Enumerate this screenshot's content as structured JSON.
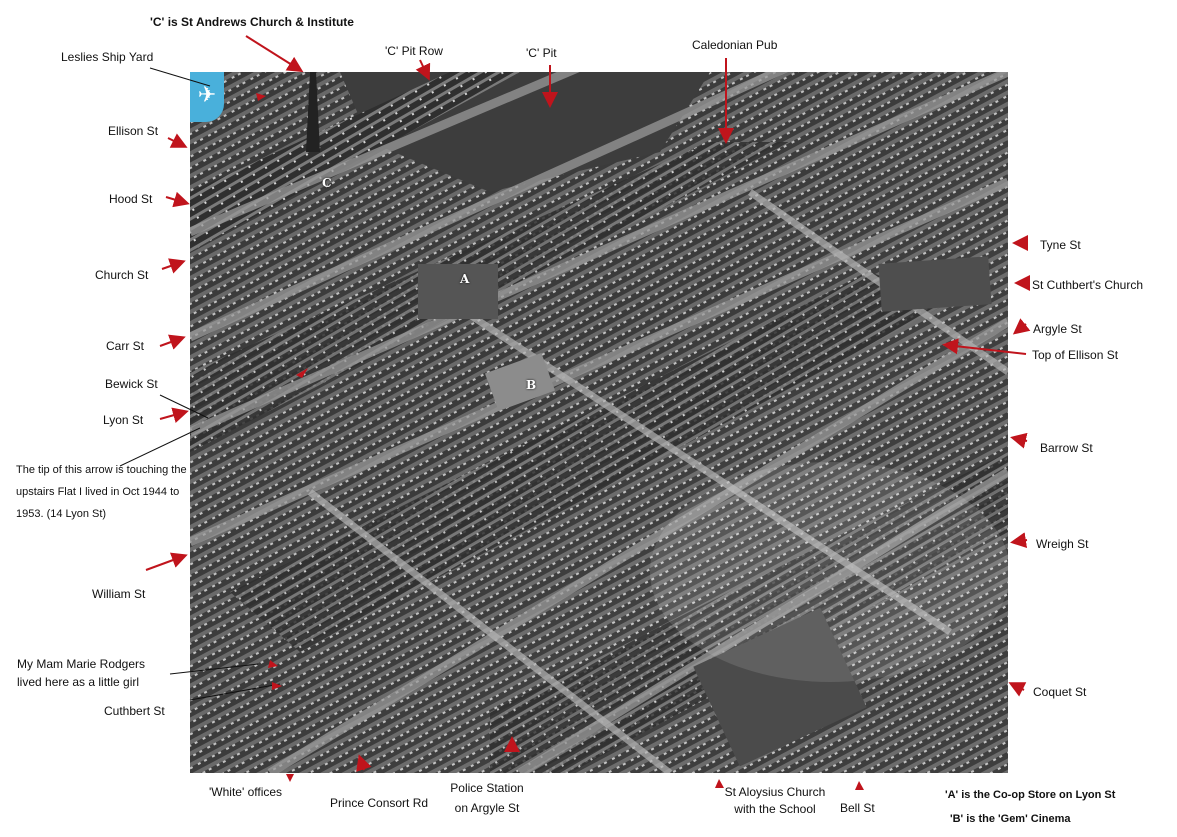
{
  "labels": {
    "st_andrews": "'C' is St Andrews Church & Institute",
    "leslies": "Leslies Ship Yard",
    "pit_row": "'C' Pit Row",
    "pit": "'C' Pit",
    "caledonian": "Caledonian Pub",
    "ellison": "Ellison St",
    "hood": "Hood St",
    "church": "Church St",
    "carr": "Carr St",
    "bewick": "Bewick St",
    "lyon": "Lyon St",
    "arrow_note": [
      "The tip of this arrow is touching the",
      "upstairs Flat I lived in Oct 1944 to",
      "1953. (14 Lyon St)"
    ],
    "william": "William St",
    "mam": [
      "My Mam Marie Rodgers",
      "lived here as a little girl"
    ],
    "cuthbert": "Cuthbert St",
    "white_offices": "'White'  offices",
    "prince_consort": "Prince Consort Rd",
    "police": [
      "Police Station",
      "on Argyle St"
    ],
    "st_aloysius": [
      "St Aloysius Church",
      "with the School"
    ],
    "bell": "Bell St",
    "tyne": "Tyne St",
    "st_cuthberts": "St Cuthbert's Church",
    "argyle": "Argyle St",
    "top_ellison": "Top of Ellison St",
    "barrow": "Barrow St",
    "wreigh": "Wreigh St",
    "coquet": "Coquet St",
    "legend_a": "'A' is the Co-op Store on Lyon St",
    "legend_b": "'B' is the 'Gem' Cinema"
  },
  "photo_letters": {
    "a": "A",
    "b": "B",
    "c": "C"
  },
  "icons": {
    "map_badge": "airplane-icon"
  },
  "colors": {
    "arrow": "#c0141c",
    "badge": "#49b0db"
  }
}
